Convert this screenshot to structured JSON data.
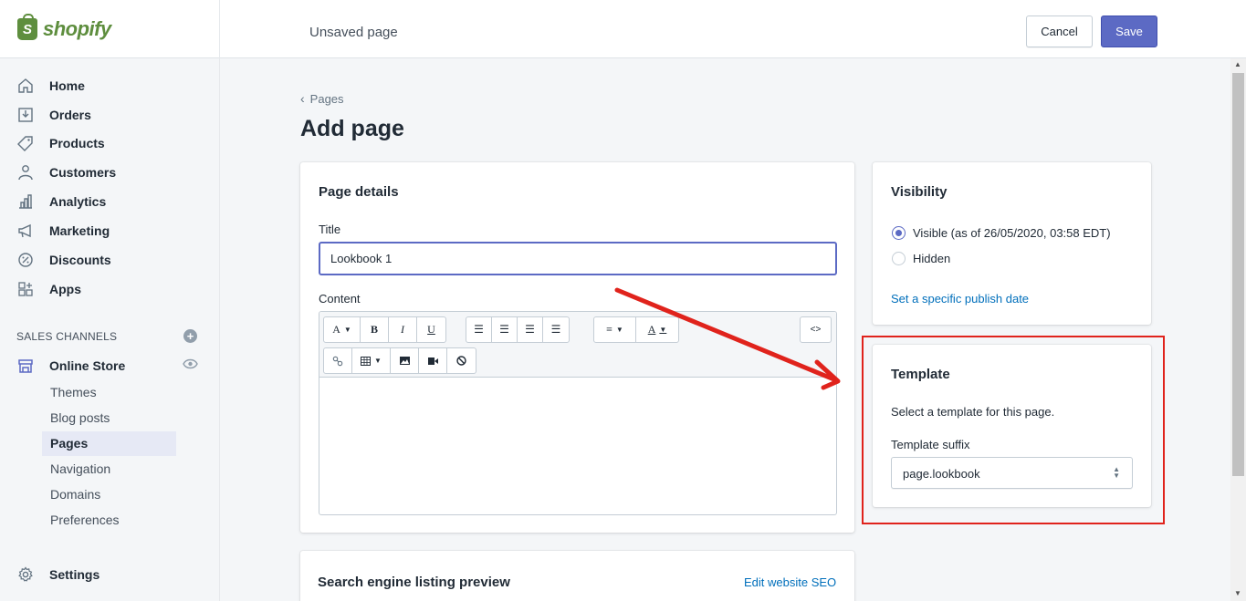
{
  "topbar": {
    "brand": "shopify",
    "page_status": "Unsaved page",
    "cancel_label": "Cancel",
    "save_label": "Save"
  },
  "sidebar": {
    "items": [
      {
        "label": "Home",
        "icon": "home-icon"
      },
      {
        "label": "Orders",
        "icon": "orders-icon"
      },
      {
        "label": "Products",
        "icon": "tag-icon"
      },
      {
        "label": "Customers",
        "icon": "person-icon"
      },
      {
        "label": "Analytics",
        "icon": "bar-chart-icon"
      },
      {
        "label": "Marketing",
        "icon": "megaphone-icon"
      },
      {
        "label": "Discounts",
        "icon": "discount-icon"
      },
      {
        "label": "Apps",
        "icon": "apps-icon"
      }
    ],
    "sales_channels_title": "SALES CHANNELS",
    "online_store_label": "Online Store",
    "sub_items": [
      {
        "label": "Themes"
      },
      {
        "label": "Blog posts"
      },
      {
        "label": "Pages"
      },
      {
        "label": "Navigation"
      },
      {
        "label": "Domains"
      },
      {
        "label": "Preferences"
      }
    ],
    "settings_label": "Settings"
  },
  "main": {
    "breadcrumb": "Pages",
    "page_title": "Add page",
    "details": {
      "title": "Page details",
      "title_label": "Title",
      "title_value": "Lookbook 1",
      "content_label": "Content"
    },
    "visibility": {
      "title": "Visibility",
      "visible_label": "Visible (as of 26/05/2020, 03:58 EDT)",
      "hidden_label": "Hidden",
      "publish_link": "Set a specific publish date"
    },
    "template": {
      "title": "Template",
      "description": "Select a template for this page.",
      "suffix_label": "Template suffix",
      "suffix_value": "page.lookbook"
    },
    "seo": {
      "title": "Search engine listing preview",
      "edit_link": "Edit website SEO"
    }
  },
  "colors": {
    "accent": "#5c6ac4",
    "brand": "#5e8e3e",
    "annotation": "#e0231c",
    "link": "#006fbb"
  }
}
